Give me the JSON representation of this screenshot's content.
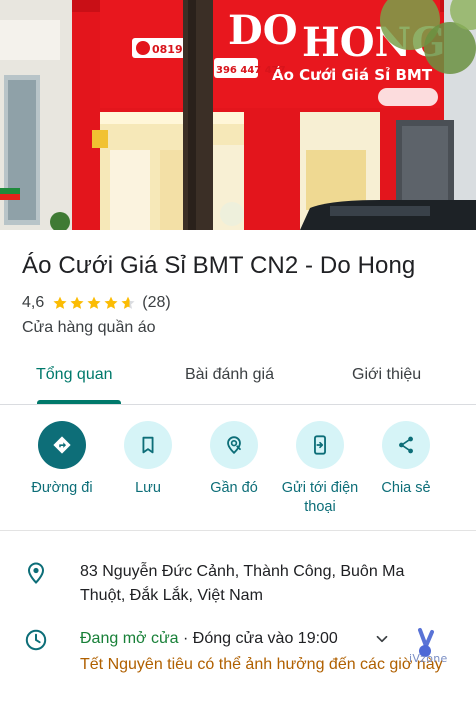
{
  "hero": {
    "sign_title": "DO HONG",
    "sign_subtitle": "Áo Cưới Giá Sỉ BMT",
    "sign_phone_left": "0819 73",
    "sign_phone_right": "396 447 477"
  },
  "place": {
    "title": "Áo Cưới Giá Sỉ BMT CN2 - Do Hong",
    "rating": "4,6",
    "rating_value": 4.6,
    "review_count": "(28)",
    "category": "Cửa hàng quần áo"
  },
  "tabs": [
    {
      "label": "Tổng quan",
      "active": true
    },
    {
      "label": "Bài đánh giá",
      "active": false
    },
    {
      "label": "Giới thiệu",
      "active": false
    }
  ],
  "actions": [
    {
      "label": "Đường đi",
      "icon": "directions-icon"
    },
    {
      "label": "Lưu",
      "icon": "bookmark-icon"
    },
    {
      "label": "Gần đó",
      "icon": "nearby-icon"
    },
    {
      "label": "Gửi tới điện thoại",
      "icon": "send-to-phone-icon"
    },
    {
      "label": "Chia sẻ",
      "icon": "share-icon"
    }
  ],
  "info": {
    "address": "83 Nguyễn Đức Cảnh, Thành Công, Buôn Ma Thuột, Đắk Lắk, Việt Nam",
    "hours_status": "Đang mở cửa",
    "hours_separator": " · ",
    "hours_closing": "Đóng cửa vào 19:00",
    "holiday_notice": "Tết Nguyên tiêu có thể ảnh hưởng đến các giờ này"
  },
  "watermark": {
    "text": "iVzone"
  },
  "colors": {
    "accent": "#0d6e78",
    "tab_active": "#00796b",
    "open": "#188038",
    "warning": "#b06000",
    "star": "#fbbc04",
    "sign_red": "#e3151c"
  }
}
